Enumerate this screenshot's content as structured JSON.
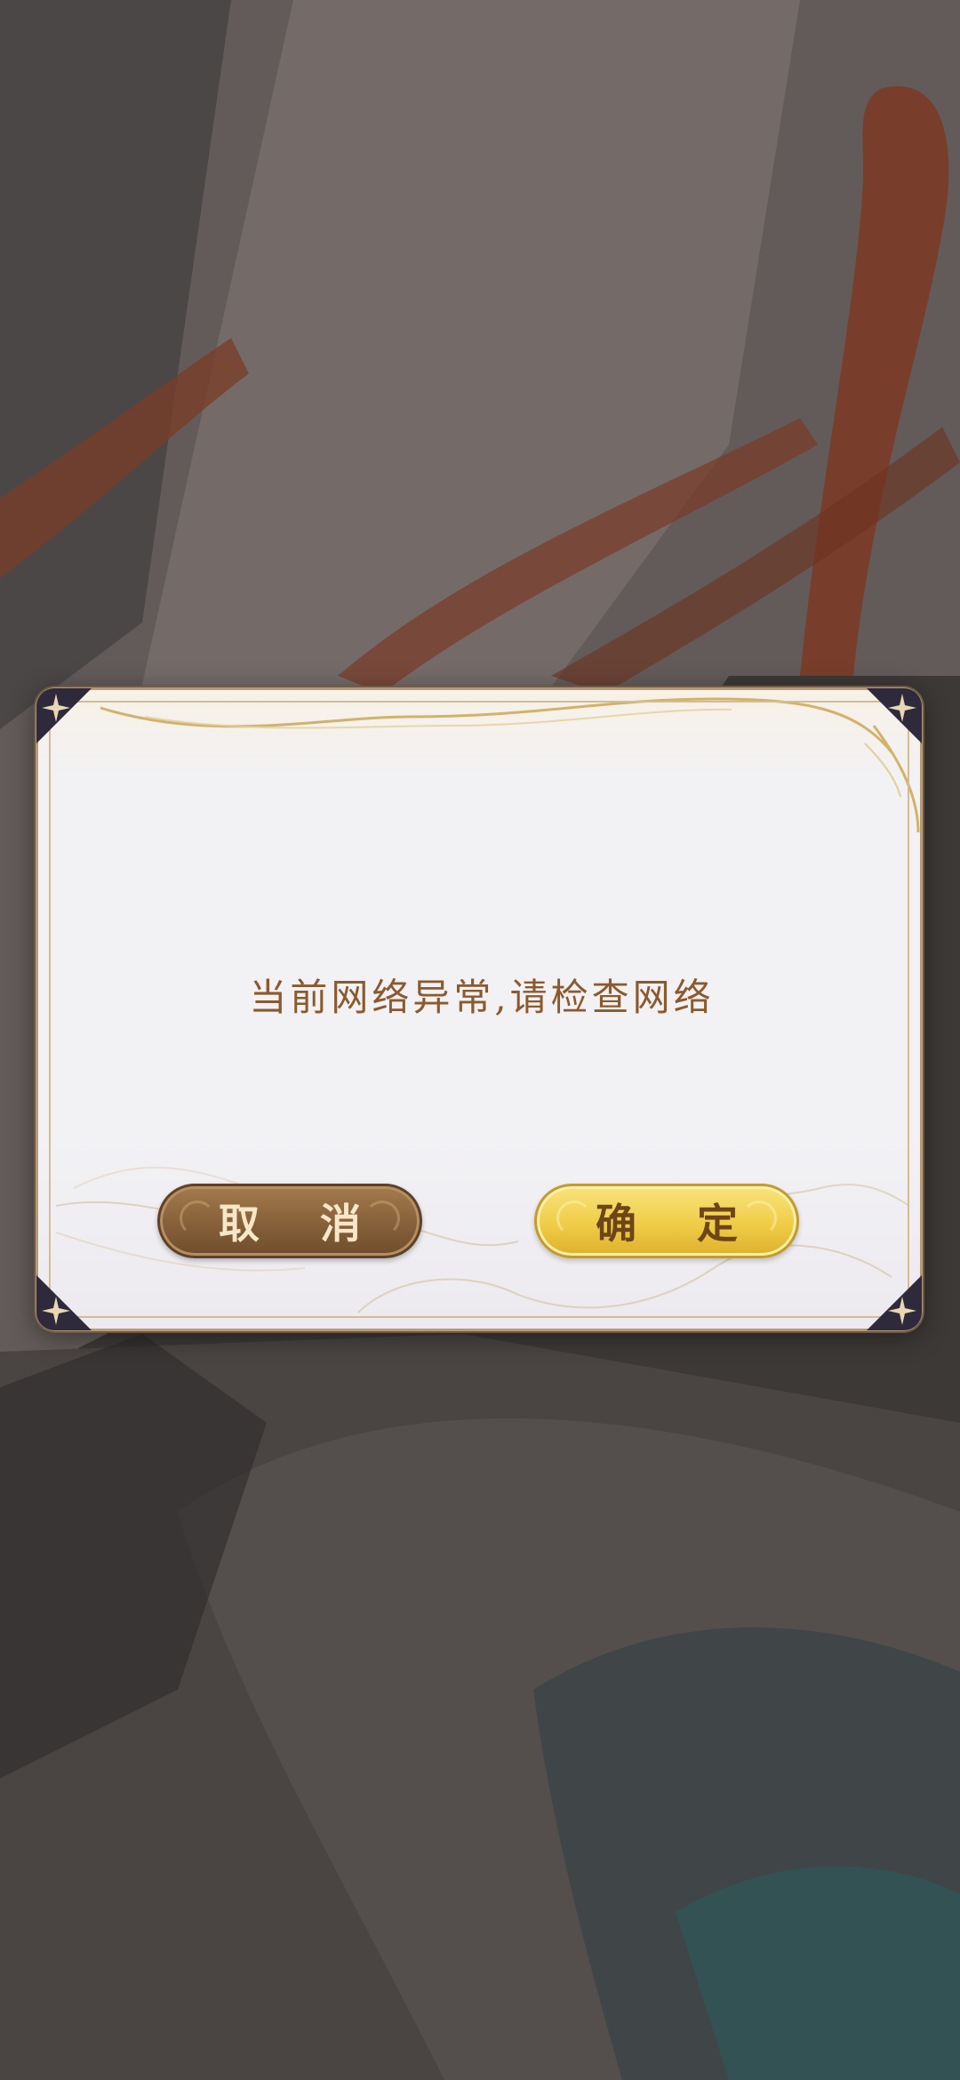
{
  "dialog": {
    "message": "当前网络异常,请检查网络",
    "cancel_label": "取 消",
    "confirm_label": "确 定"
  },
  "colors": {
    "message_text": "#8a5a2e",
    "cancel_button": "#86603a",
    "confirm_button": "#f0cd48",
    "corner_ornament": "#2e2a3c"
  },
  "icons": {
    "corner": "four-point-star-icon"
  }
}
